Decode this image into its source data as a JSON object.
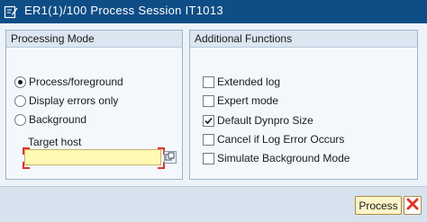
{
  "window": {
    "title": "ER1(1)/100 Process Session IT1013",
    "title_icon": "edit-window-icon"
  },
  "processing_mode": {
    "title": "Processing Mode",
    "options": [
      {
        "label": "Process/foreground",
        "selected": true
      },
      {
        "label": "Display errors only",
        "selected": false
      },
      {
        "label": "Background",
        "selected": false
      }
    ],
    "target_host": {
      "label": "Target host",
      "value": "",
      "help_icon": "value-help-icon"
    }
  },
  "additional_functions": {
    "title": "Additional Functions",
    "options": [
      {
        "label": "Extended log",
        "checked": false
      },
      {
        "label": "Expert mode",
        "checked": false
      },
      {
        "label": "Default Dynpro Size",
        "checked": true
      },
      {
        "label": "Cancel if Log Error Occurs",
        "checked": false
      },
      {
        "label": "Simulate Background Mode",
        "checked": false
      }
    ]
  },
  "footer": {
    "process_label": "Process",
    "cancel_icon": "cancel-icon"
  },
  "colors": {
    "titlebar": "#0f4d86",
    "content_bg": "#edf3f9",
    "group_header": "#dbe6f1",
    "footer_bg": "#d6e3ef",
    "required_input_bg": "#fff9b3",
    "required_marker": "#e0342b",
    "process_button_bg": "#fdf5c9",
    "cancel_icon": "#e0342b"
  }
}
